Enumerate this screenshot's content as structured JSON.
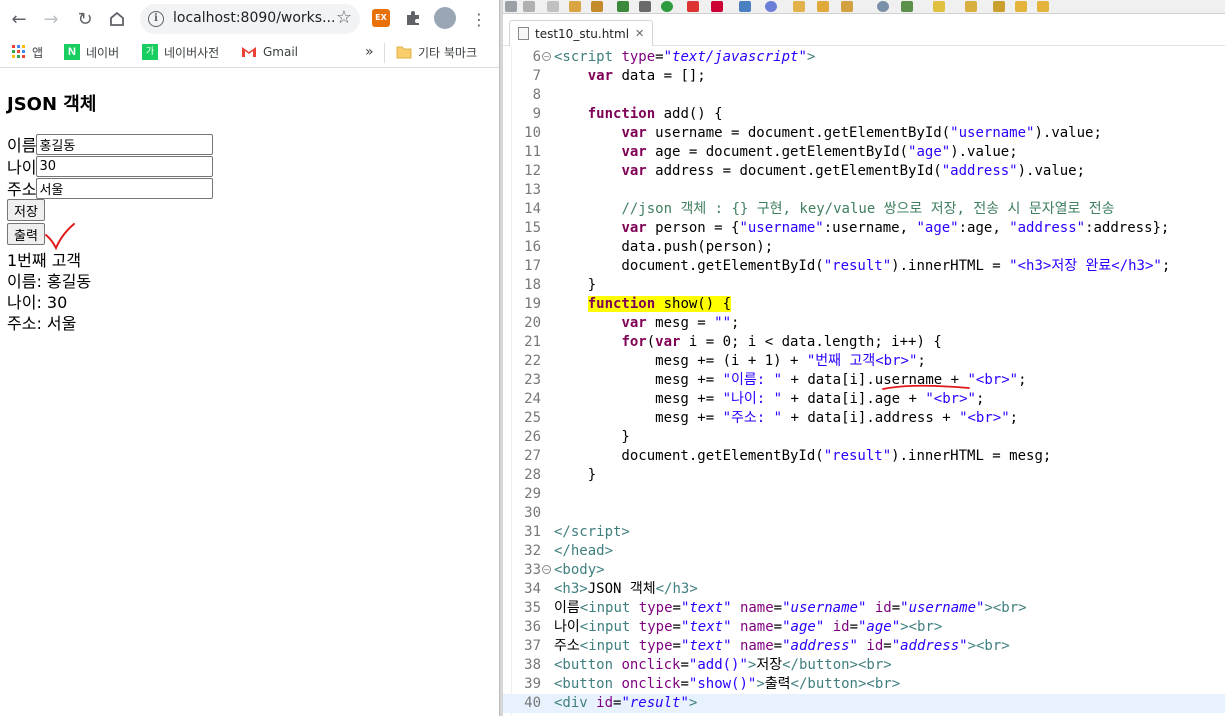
{
  "browser": {
    "url": "localhost:8090/works...",
    "bookmarks": [
      {
        "label": "앱",
        "icon": "apps-icon"
      },
      {
        "label": "네이버",
        "icon": "naver-icon"
      },
      {
        "label": "네이버사전",
        "icon": "naver-dictionary-icon"
      },
      {
        "label": "Gmail",
        "icon": "gmail-icon"
      }
    ],
    "bookmarks_more": "»",
    "other_bookmarks": "기타 북마크",
    "page": {
      "heading": "JSON 객체",
      "fields": [
        {
          "label": "이름",
          "value": "홍길동"
        },
        {
          "label": "나이",
          "value": "30"
        },
        {
          "label": "주소",
          "value": "서울"
        }
      ],
      "save_button": "저장",
      "show_button": "출력",
      "result": [
        "1번째 고객",
        "이름: 홍길동",
        "나이: 30",
        "주소: 서울"
      ]
    }
  },
  "ide": {
    "tab_title": "test10_stu.html",
    "code_lines": [
      {
        "n": "6",
        "fold": true
      },
      {
        "n": "7"
      },
      {
        "n": "8"
      },
      {
        "n": "9"
      },
      {
        "n": "10"
      },
      {
        "n": "11"
      },
      {
        "n": "12"
      },
      {
        "n": "13"
      },
      {
        "n": "14"
      },
      {
        "n": "15"
      },
      {
        "n": "16"
      },
      {
        "n": "17"
      },
      {
        "n": "18"
      },
      {
        "n": "19"
      },
      {
        "n": "20"
      },
      {
        "n": "21"
      },
      {
        "n": "22"
      },
      {
        "n": "23"
      },
      {
        "n": "24"
      },
      {
        "n": "25"
      },
      {
        "n": "26"
      },
      {
        "n": "27"
      },
      {
        "n": "28"
      },
      {
        "n": "29"
      },
      {
        "n": "30"
      },
      {
        "n": "31"
      },
      {
        "n": "32"
      },
      {
        "n": "33",
        "fold": true
      },
      {
        "n": "34"
      },
      {
        "n": "35"
      },
      {
        "n": "36"
      },
      {
        "n": "37"
      },
      {
        "n": "38"
      },
      {
        "n": "39"
      },
      {
        "n": "40"
      }
    ]
  },
  "colors": {
    "keyword": "#7f0055",
    "string": "#2a00ff",
    "comment": "#3f7f5f",
    "tag": "#3f7f7f",
    "attribute": "#7f007f",
    "highlight": "#ffff00",
    "annotation_red": "#e0191b"
  }
}
